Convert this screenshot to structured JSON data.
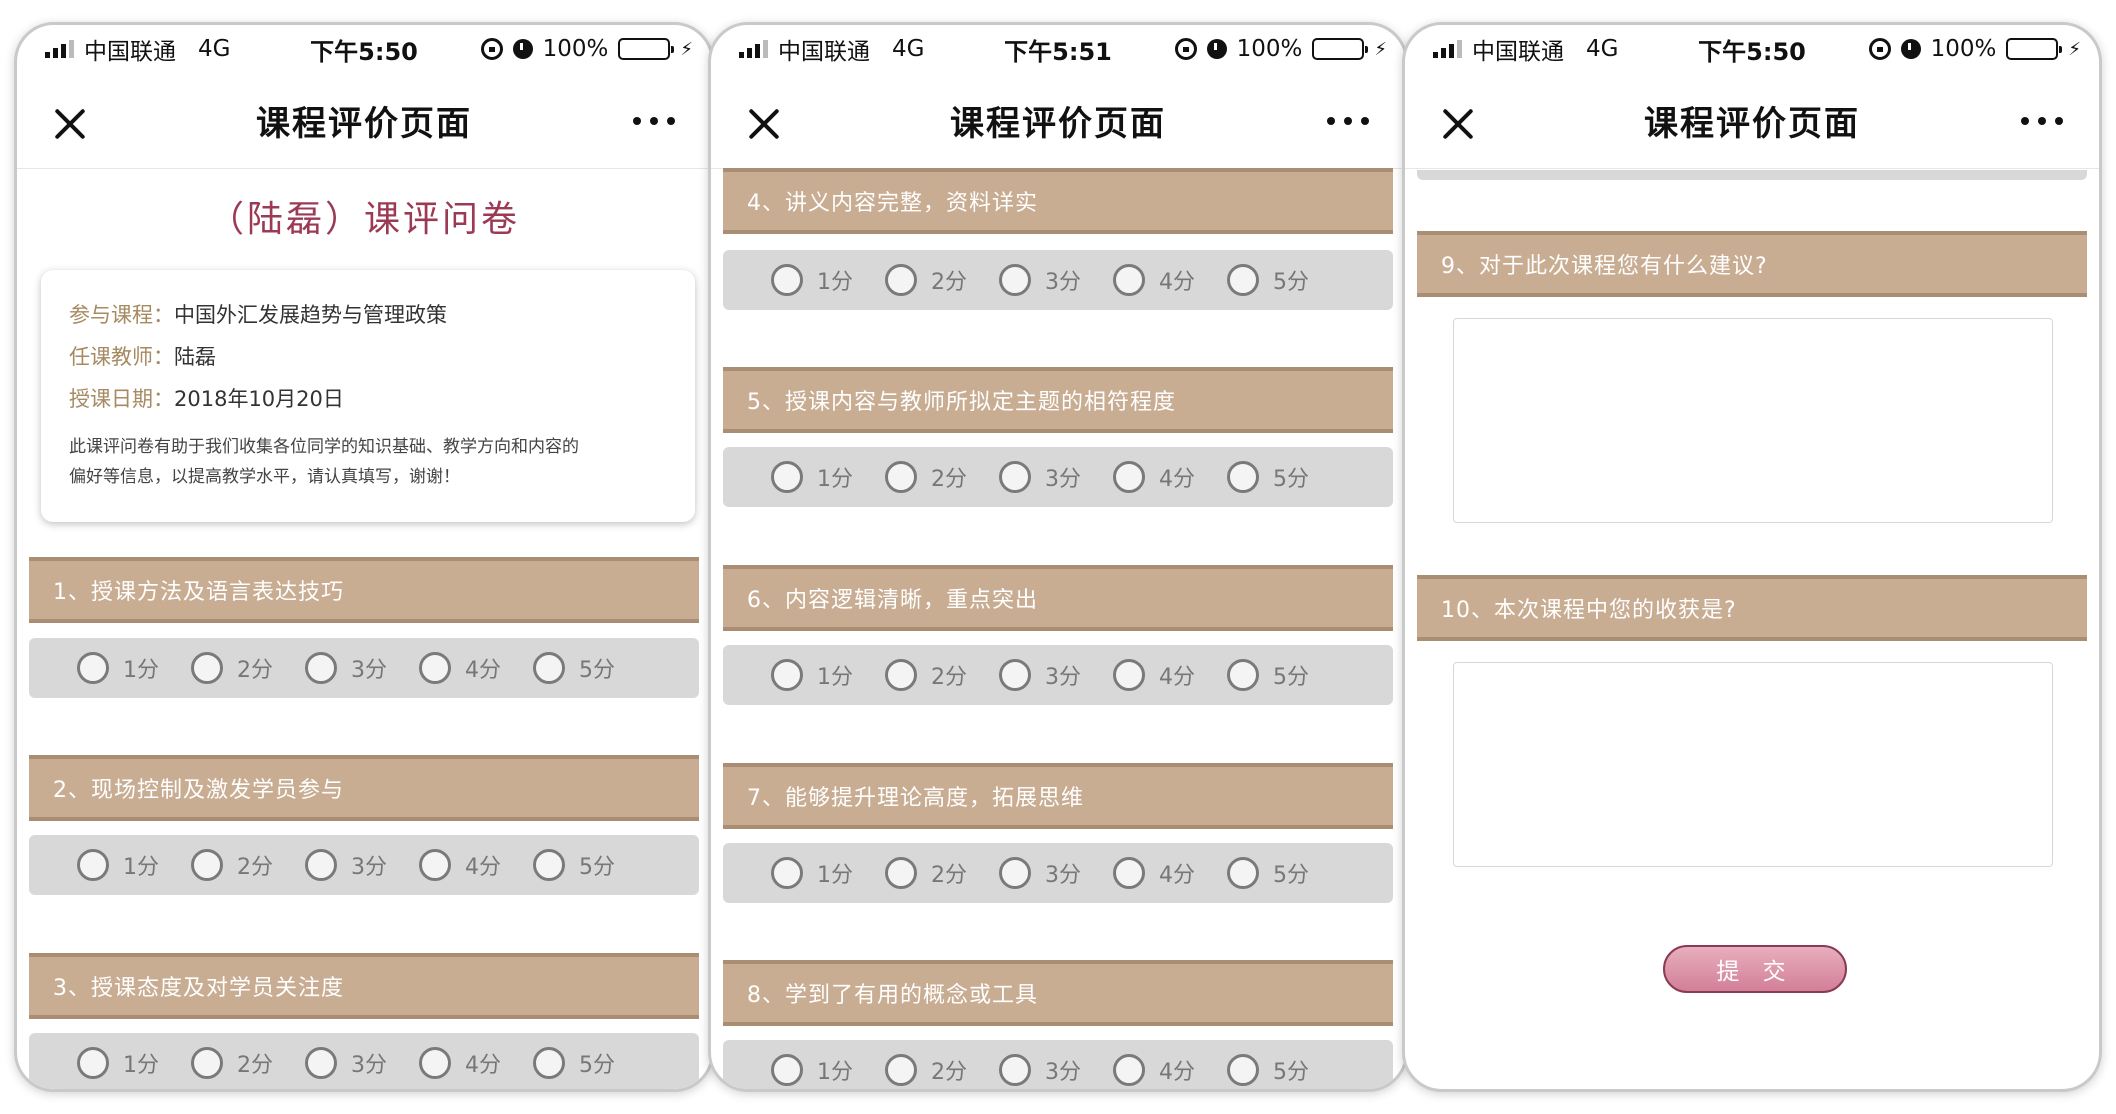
{
  "status": {
    "carrier": "中国联通",
    "network": "4G",
    "time_1": "下午5:50",
    "time_2": "下午5:51",
    "time_3": "下午5:50",
    "battery": "100%",
    "battery_color": "#4cd964"
  },
  "nav": {
    "title": "课程评价页面"
  },
  "survey": {
    "title": "（陆磊）课评问卷",
    "course_label": "参与课程：",
    "course_value": "中国外汇发展趋势与管理政策",
    "teacher_label": "任课教师：",
    "teacher_value": "陆磊",
    "date_label": "授课日期：",
    "date_value": "2018年10月20日",
    "note_line1": "此课评问卷有助于我们收集各位同学的知识基础、教学方向和内容的",
    "note_line2": "偏好等信息，以提高教学水平，请认真填写，谢谢！"
  },
  "rating_options": [
    "1分",
    "2分",
    "3分",
    "4分",
    "5分"
  ],
  "questions": [
    "1、授课方法及语言表达技巧",
    "2、现场控制及激发学员参与",
    "3、授课态度及对学员关注度",
    "4、讲义内容完整，资料详实",
    "5、授课内容与教师所拟定主题的相符程度",
    "6、内容逻辑清晰，重点突出",
    "7、能够提升理论高度，拓展思维",
    "8、学到了有用的概念或工具",
    "9、对于此次课程您有什么建议?",
    "10、本次课程中您的收获是?"
  ],
  "submit_label": "提 交",
  "colors": {
    "question_bar": "#c9ad93",
    "title_accent": "#9b3a55",
    "label_gold": "#a68a62",
    "rating_bg": "#d8d8d8"
  }
}
